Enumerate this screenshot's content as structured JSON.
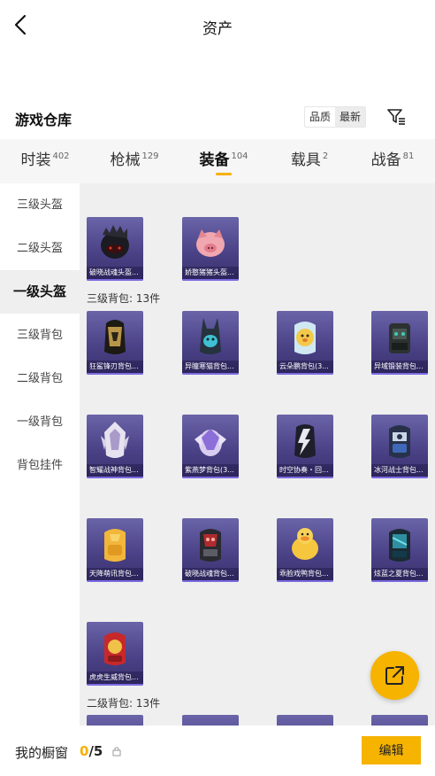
{
  "header": {
    "title": "资产",
    "back_icon": "chevron-left-icon"
  },
  "warehouse": {
    "title": "游戏仓库",
    "sort_options": [
      "品质",
      "最新"
    ],
    "selected_sort": "最新",
    "filter_icon": "filter-icon"
  },
  "tabs": [
    {
      "label": "时装",
      "count": "402"
    },
    {
      "label": "枪械",
      "count": "129"
    },
    {
      "label": "装备",
      "count": "104",
      "active": true
    },
    {
      "label": "载具",
      "count": "2"
    },
    {
      "label": "战备",
      "count": "81"
    }
  ],
  "sidebar": {
    "items": [
      "三级头盔",
      "二级头盔",
      "一级头盔",
      "三级背包",
      "二级背包",
      "一级背包",
      "背包挂件"
    ],
    "active": "一级头盔"
  },
  "content": {
    "helmets": [
      "破晓战魂头盔...",
      "娇憨猪猪头盔..."
    ],
    "section_level3": "三级背包: 13件",
    "level3_items": [
      "狂鲨锋刃背包...",
      "异瞳寒猫背包...",
      "云朵鹏背包(3...",
      "异域锻装背包...",
      "智耀战神背包...",
      "紫燕梦背包(3...",
      "时空协奏・回...",
      "冰河战士背包...",
      "天降萌讯背包...",
      "破晓战魂背包...",
      "乖脸戏鸭背包...",
      "炫蓝之夏背包...",
      "虎虎生威背包..."
    ],
    "section_level2": "二级背包: 13件"
  },
  "fab": {
    "icon": "share-icon"
  },
  "bottom_bar": {
    "label": "我的橱窗",
    "current": "0",
    "total": "/5",
    "lock_icon": "lock-icon",
    "edit_label": "编辑"
  },
  "colors": {
    "accent": "#f6b300",
    "card_bg": "#4b4287",
    "content_bg": "#efefef"
  }
}
